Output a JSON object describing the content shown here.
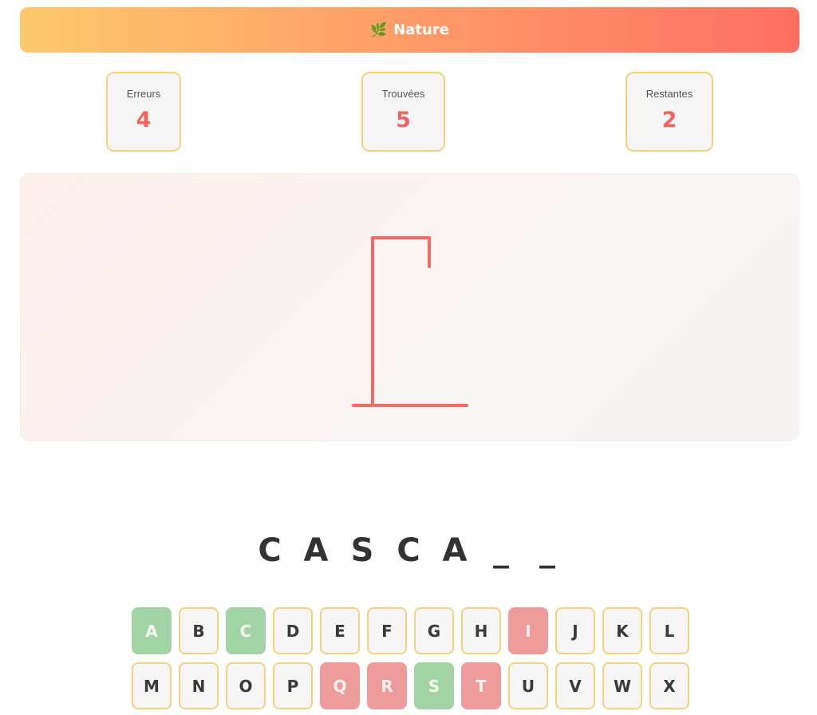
{
  "header": {
    "icon": "leaf-icon",
    "icon_glyph": "🌿",
    "category": "Nature"
  },
  "stats": [
    {
      "label": "Erreurs",
      "value": "4"
    },
    {
      "label": "Trouvées",
      "value": "5"
    },
    {
      "label": "Restantes",
      "value": "2"
    }
  ],
  "colors": {
    "accent": "#f2645f",
    "border": "#f7d27a",
    "correct": "#a3d4a5",
    "wrong": "#ee9b9b"
  },
  "word": [
    "C",
    "A",
    "S",
    "C",
    "A",
    "_",
    "_"
  ],
  "keyboard": {
    "row1": [
      {
        "letter": "A",
        "state": "correct"
      },
      {
        "letter": "B",
        "state": "unused"
      },
      {
        "letter": "C",
        "state": "correct"
      },
      {
        "letter": "D",
        "state": "unused"
      },
      {
        "letter": "E",
        "state": "unused"
      },
      {
        "letter": "F",
        "state": "unused"
      },
      {
        "letter": "G",
        "state": "unused"
      },
      {
        "letter": "H",
        "state": "unused"
      },
      {
        "letter": "I",
        "state": "wrong"
      },
      {
        "letter": "J",
        "state": "unused"
      },
      {
        "letter": "K",
        "state": "unused"
      },
      {
        "letter": "L",
        "state": "unused"
      }
    ],
    "row2": [
      {
        "letter": "M",
        "state": "unused"
      },
      {
        "letter": "N",
        "state": "unused"
      },
      {
        "letter": "O",
        "state": "unused"
      },
      {
        "letter": "P",
        "state": "unused"
      },
      {
        "letter": "Q",
        "state": "wrong"
      },
      {
        "letter": "R",
        "state": "wrong"
      },
      {
        "letter": "S",
        "state": "correct"
      },
      {
        "letter": "T",
        "state": "wrong"
      },
      {
        "letter": "U",
        "state": "unused"
      },
      {
        "letter": "V",
        "state": "unused"
      },
      {
        "letter": "W",
        "state": "unused"
      },
      {
        "letter": "X",
        "state": "unused"
      }
    ]
  }
}
